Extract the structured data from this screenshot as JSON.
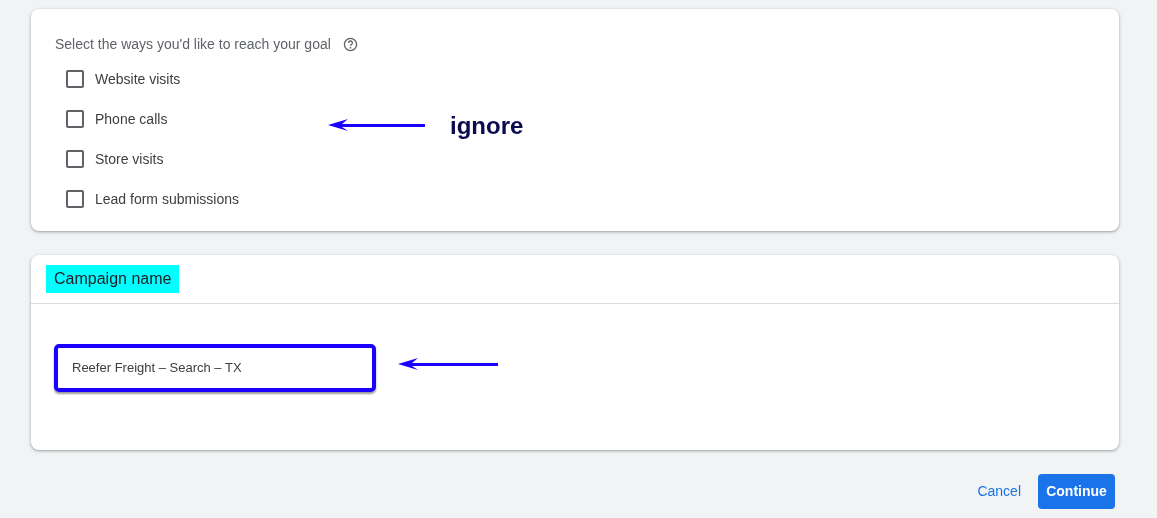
{
  "goal_card": {
    "heading": "Select the ways you'd like to reach your goal",
    "options": [
      {
        "label": "Website visits",
        "checked": false
      },
      {
        "label": "Phone calls",
        "checked": false
      },
      {
        "label": "Store visits",
        "checked": false
      },
      {
        "label": "Lead form submissions",
        "checked": false
      }
    ],
    "annotation": {
      "text": "ignore"
    }
  },
  "name_card": {
    "heading": "Campaign name",
    "highlighted": true,
    "value": "Reefer Freight – Search – TX",
    "outlined": true,
    "annotation_arrow": true
  },
  "buttons": [
    {
      "label": "Cancel",
      "kind": "text"
    },
    {
      "label": "Continue",
      "kind": "primary"
    }
  ]
}
